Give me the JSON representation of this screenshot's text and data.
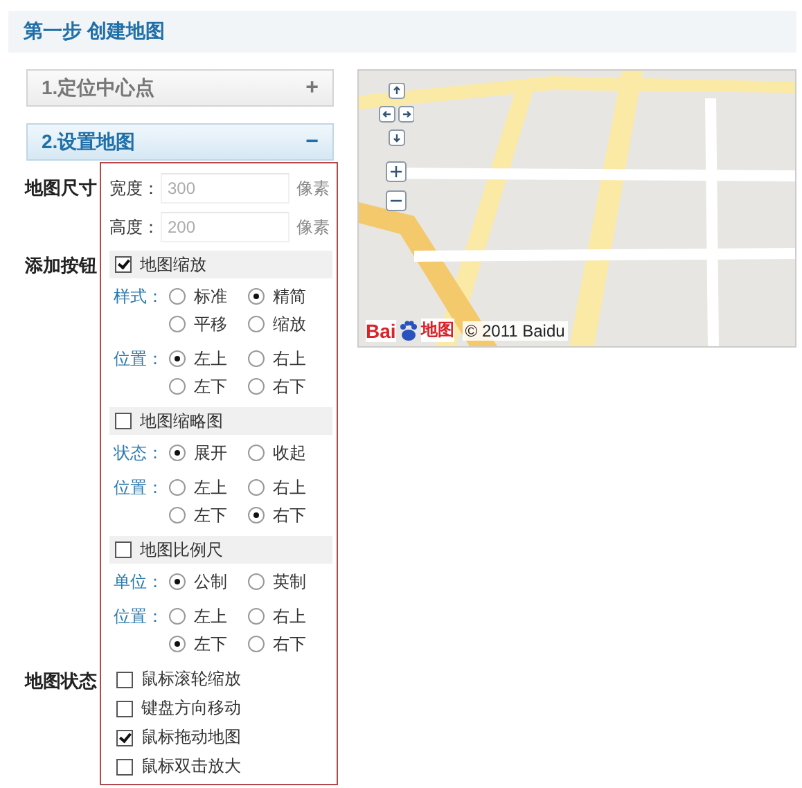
{
  "header": {
    "title": "第一步 创建地图"
  },
  "steps": [
    {
      "label": "1.定位中心点",
      "expanded": false,
      "toggle": "+"
    },
    {
      "label": "2.设置地图",
      "expanded": true,
      "toggle": "−"
    }
  ],
  "size": {
    "label": "地图尺寸",
    "fields": [
      {
        "label": "宽度：",
        "placeholder": "300",
        "unit": "像素"
      },
      {
        "label": "高度：",
        "placeholder": "200",
        "unit": "像素"
      }
    ]
  },
  "controls": {
    "label": "添加按钮",
    "groups": [
      {
        "title": "地图缩放",
        "checked": true,
        "settings": [
          {
            "label": "样式：",
            "options": [
              {
                "label": "标准",
                "selected": false
              },
              {
                "label": "精简",
                "selected": true
              },
              {
                "label": "平移",
                "selected": false
              },
              {
                "label": "缩放",
                "selected": false
              }
            ]
          },
          {
            "label": "位置：",
            "options": [
              {
                "label": "左上",
                "selected": true
              },
              {
                "label": "右上",
                "selected": false
              },
              {
                "label": "左下",
                "selected": false
              },
              {
                "label": "右下",
                "selected": false
              }
            ]
          }
        ]
      },
      {
        "title": "地图缩略图",
        "checked": false,
        "settings": [
          {
            "label": "状态：",
            "options": [
              {
                "label": "展开",
                "selected": true
              },
              {
                "label": "收起",
                "selected": false
              }
            ]
          },
          {
            "label": "位置：",
            "options": [
              {
                "label": "左上",
                "selected": false
              },
              {
                "label": "右上",
                "selected": false
              },
              {
                "label": "左下",
                "selected": false
              },
              {
                "label": "右下",
                "selected": true
              }
            ]
          }
        ]
      },
      {
        "title": "地图比例尺",
        "checked": false,
        "settings": [
          {
            "label": "单位：",
            "options": [
              {
                "label": "公制",
                "selected": true
              },
              {
                "label": "英制",
                "selected": false
              }
            ]
          },
          {
            "label": "位置：",
            "options": [
              {
                "label": "左上",
                "selected": false
              },
              {
                "label": "右上",
                "selected": false
              },
              {
                "label": "左下",
                "selected": true
              },
              {
                "label": "右下",
                "selected": false
              }
            ]
          }
        ]
      }
    ]
  },
  "status": {
    "label": "地图状态",
    "options": [
      {
        "label": "鼠标滚轮缩放",
        "checked": false
      },
      {
        "label": "键盘方向移动",
        "checked": false
      },
      {
        "label": "鼠标拖动地图",
        "checked": true
      },
      {
        "label": "鼠标双击放大",
        "checked": false
      }
    ]
  },
  "map": {
    "logo": [
      "Bai",
      "地图"
    ],
    "copyright": "© 2011 Baidu"
  }
}
